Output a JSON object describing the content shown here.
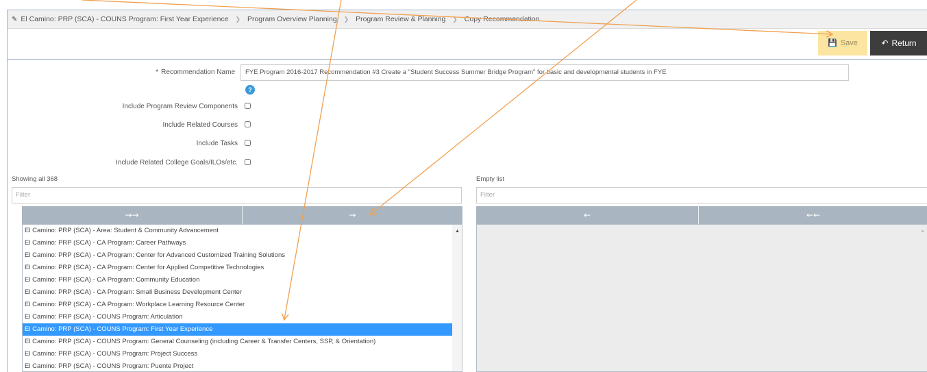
{
  "breadcrumb": {
    "items": [
      "El Camino: PRP (SCA) - COUNS Program: First Year Experience",
      "Program Overview Planning",
      "Program Review & Planning",
      "Copy Recommendation"
    ]
  },
  "toolbar": {
    "save_label": "Save",
    "return_label": "Return"
  },
  "form": {
    "required_mark": "*",
    "recommendation_label": "Recommendation Name",
    "recommendation_value": "FYE Program 2016-2017 Recommendation #3 Create a \"Student Success Summer Bridge Program\" for basic and developmental students in FYE",
    "help_glyph": "?",
    "checkboxes": [
      "Include Program Review Components",
      "Include Related Courses",
      "Include Tasks",
      "Include Related College Goals/ILOs/etc."
    ]
  },
  "left_list": {
    "status": "Showing all 368",
    "filter_placeholder": "Filter",
    "move_all_glyph": "→→",
    "move_selected_glyph": "→",
    "items": [
      "El Camino: PRP (SCA) - Area: Student & Community Advancement",
      "El Camino: PRP (SCA) - CA Program: Career Pathways",
      "El Camino: PRP (SCA) - CA Program: Center for Advanced Customized Training Solutions",
      "El Camino: PRP (SCA) - CA Program: Center for Applied Competitive Technologies",
      "El Camino: PRP (SCA) - CA Program: Community Education",
      "El Camino: PRP (SCA) - CA Program: Small Business Development Center",
      "El Camino: PRP (SCA) - CA Program: Workplace Learning Resource Center",
      "El Camino: PRP (SCA) - COUNS Program: Articulation",
      "El Camino: PRP (SCA) - COUNS Program: First Year Experience",
      "El Camino: PRP (SCA) - COUNS Program: General Counseling (including Career & Transfer Centers, SSP, & Orientation)",
      "El Camino: PRP (SCA) - COUNS Program: Project Success",
      "El Camino: PRP (SCA) - COUNS Program: Puente Project"
    ],
    "selected_index": 8
  },
  "right_list": {
    "status": "Empty list",
    "filter_placeholder": "Filter",
    "remove_selected_glyph": "←",
    "remove_all_glyph": "←←"
  },
  "colors": {
    "selection": "#3399ff",
    "save_bg": "#fbe5a0",
    "return_bg": "#3d3d3d",
    "annotation_arrow": "#f0a050",
    "move_bar": "#a9b5c0"
  }
}
